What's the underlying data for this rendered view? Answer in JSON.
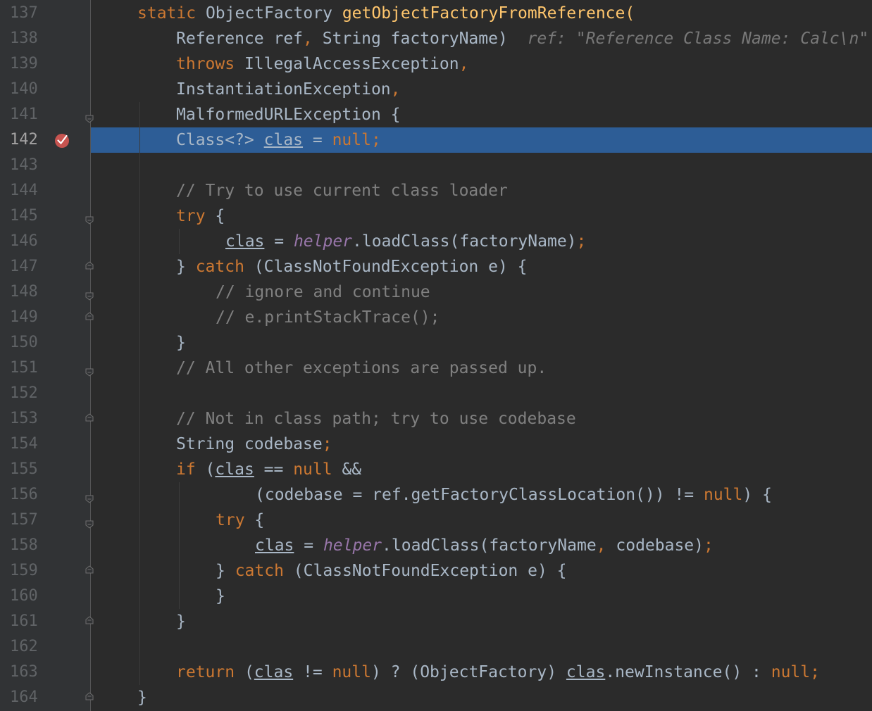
{
  "editor": {
    "lines": [
      {
        "num": "137",
        "tokens": [
          {
            "t": "static ",
            "c": "kw"
          },
          {
            "t": "ObjectFactory ",
            "c": ""
          },
          {
            "t": "getObjectFactoryFromReference",
            "c": "fn"
          },
          {
            "t": "(",
            "c": "fn"
          }
        ]
      },
      {
        "num": "138",
        "tokens": [
          {
            "t": "Reference ref",
            "c": ""
          },
          {
            "t": ", ",
            "c": "kw"
          },
          {
            "t": "String factoryName)  ",
            "c": ""
          },
          {
            "t": "ref: \"Reference Class Name: Calc\\n\"",
            "c": "hint"
          }
        ]
      },
      {
        "num": "139",
        "tokens": [
          {
            "t": "throws ",
            "c": "kw"
          },
          {
            "t": "IllegalAccessException",
            "c": ""
          },
          {
            "t": ",",
            "c": "kw"
          }
        ]
      },
      {
        "num": "140",
        "tokens": [
          {
            "t": "InstantiationException",
            "c": ""
          },
          {
            "t": ",",
            "c": "kw"
          }
        ]
      },
      {
        "num": "141",
        "tokens": [
          {
            "t": "MalformedURLException {",
            "c": ""
          }
        ]
      },
      {
        "num": "142",
        "tokens": [
          {
            "t": "Class<?> ",
            "c": ""
          },
          {
            "t": "clas",
            "c": "ul"
          },
          {
            "t": " = ",
            "c": ""
          },
          {
            "t": "null;",
            "c": "kw"
          }
        ]
      },
      {
        "num": "143",
        "tokens": []
      },
      {
        "num": "144",
        "tokens": [
          {
            "t": "// Try to use current class loader",
            "c": "cm"
          }
        ]
      },
      {
        "num": "145",
        "tokens": [
          {
            "t": "try ",
            "c": "kw"
          },
          {
            "t": "{",
            "c": ""
          }
        ]
      },
      {
        "num": "146",
        "tokens": [
          {
            "t": "clas",
            "c": "ul"
          },
          {
            "t": " = ",
            "c": ""
          },
          {
            "t": "helper",
            "c": "fld"
          },
          {
            "t": ".loadClass(factoryName)",
            "c": ""
          },
          {
            "t": ";",
            "c": "kw"
          }
        ]
      },
      {
        "num": "147",
        "tokens": [
          {
            "t": "} ",
            "c": ""
          },
          {
            "t": "catch ",
            "c": "kw"
          },
          {
            "t": "(ClassNotFoundException e) {",
            "c": ""
          }
        ]
      },
      {
        "num": "148",
        "tokens": [
          {
            "t": "// ignore and continue",
            "c": "cm"
          }
        ]
      },
      {
        "num": "149",
        "tokens": [
          {
            "t": "// e.printStackTrace();",
            "c": "cm"
          }
        ]
      },
      {
        "num": "150",
        "tokens": [
          {
            "t": "}",
            "c": ""
          }
        ]
      },
      {
        "num": "151",
        "tokens": [
          {
            "t": "// All other exceptions are passed up.",
            "c": "cm"
          }
        ]
      },
      {
        "num": "152",
        "tokens": []
      },
      {
        "num": "153",
        "tokens": [
          {
            "t": "// Not in class path; try to use codebase",
            "c": "cm"
          }
        ]
      },
      {
        "num": "154",
        "tokens": [
          {
            "t": "String codebase",
            "c": ""
          },
          {
            "t": ";",
            "c": "kw"
          }
        ]
      },
      {
        "num": "155",
        "tokens": [
          {
            "t": "if ",
            "c": "kw"
          },
          {
            "t": "(",
            "c": ""
          },
          {
            "t": "clas",
            "c": "ul"
          },
          {
            "t": " == ",
            "c": ""
          },
          {
            "t": "null ",
            "c": "kw"
          },
          {
            "t": "&&",
            "c": ""
          }
        ]
      },
      {
        "num": "156",
        "tokens": [
          {
            "t": "(codebase = ref.getFactoryClassLocation()) != ",
            "c": ""
          },
          {
            "t": "null",
            "c": "kw"
          },
          {
            "t": ") {",
            "c": ""
          }
        ]
      },
      {
        "num": "157",
        "tokens": [
          {
            "t": "try ",
            "c": "kw"
          },
          {
            "t": "{",
            "c": ""
          }
        ]
      },
      {
        "num": "158",
        "tokens": [
          {
            "t": "clas",
            "c": "ul"
          },
          {
            "t": " = ",
            "c": ""
          },
          {
            "t": "helper",
            "c": "fld"
          },
          {
            "t": ".loadClass(factoryName",
            "c": ""
          },
          {
            "t": ", ",
            "c": "kw"
          },
          {
            "t": "codebase)",
            "c": ""
          },
          {
            "t": ";",
            "c": "kw"
          }
        ]
      },
      {
        "num": "159",
        "tokens": [
          {
            "t": "} ",
            "c": ""
          },
          {
            "t": "catch ",
            "c": "kw"
          },
          {
            "t": "(ClassNotFoundException e) {",
            "c": ""
          }
        ]
      },
      {
        "num": "160",
        "tokens": [
          {
            "t": "}",
            "c": ""
          }
        ]
      },
      {
        "num": "161",
        "tokens": [
          {
            "t": "}",
            "c": ""
          }
        ]
      },
      {
        "num": "162",
        "tokens": []
      },
      {
        "num": "163",
        "tokens": [
          {
            "t": "return ",
            "c": "kw"
          },
          {
            "t": "(",
            "c": ""
          },
          {
            "t": "clas",
            "c": "ul"
          },
          {
            "t": " != ",
            "c": ""
          },
          {
            "t": "null",
            "c": "kw"
          },
          {
            "t": ") ? (ObjectFactory) ",
            "c": ""
          },
          {
            "t": "clas",
            "c": "ul"
          },
          {
            "t": ".newInstance() : ",
            "c": ""
          },
          {
            "t": "null;",
            "c": "kw"
          }
        ]
      },
      {
        "num": "164",
        "tokens": [
          {
            "t": "}",
            "c": ""
          }
        ]
      }
    ],
    "current_line": "142",
    "breakpoint_line": "142",
    "breakpoint_icon": "breakpoint-verified-icon",
    "fold_open_lines": [
      "141",
      "145",
      "148",
      "151",
      "156",
      "157"
    ],
    "fold_close_lines": [
      "147",
      "149",
      "153",
      "159",
      "161",
      "164"
    ],
    "colors": {
      "background": "#2b2b2b",
      "gutter": "#313335",
      "current_line": "#2d5d96",
      "keyword": "#cc7832",
      "method": "#ffc66d",
      "comment": "#808080",
      "field": "#9876aa",
      "breakpoint": "#c75450"
    }
  }
}
